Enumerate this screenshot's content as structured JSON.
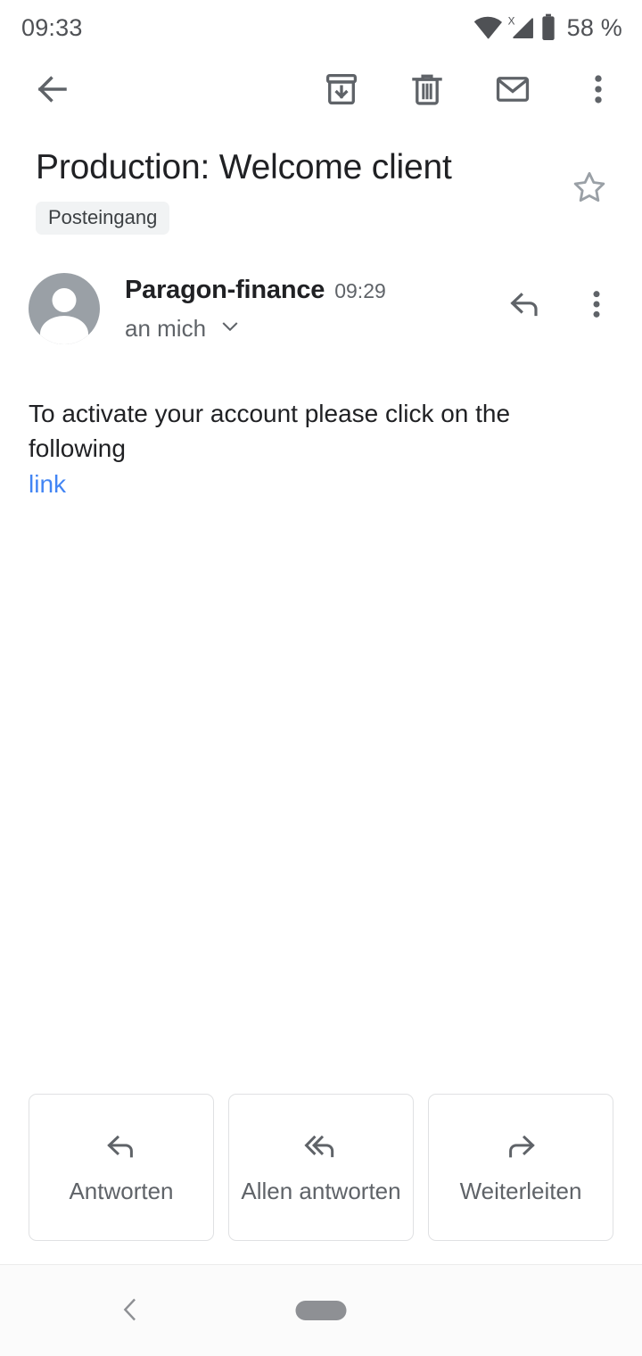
{
  "status_bar": {
    "time": "09:33",
    "battery_percent": "58 %",
    "icons": [
      "wifi-icon",
      "cellular-signal-no-service-icon",
      "battery-icon"
    ]
  },
  "toolbar": {
    "back_icon": "back-arrow-icon",
    "archive_icon": "archive-icon",
    "delete_icon": "trash-icon",
    "mark_unread_icon": "envelope-icon",
    "overflow_icon": "more-vertical-icon"
  },
  "email": {
    "subject": "Production: Welcome client",
    "label": "Posteingang",
    "starred": false,
    "star_icon": "star-outline-icon",
    "sender_name": "Paragon-finance",
    "timestamp": "09:29",
    "recipient": "an mich",
    "recipient_expand_icon": "chevron-down-icon",
    "reply_icon": "reply-arrow-icon",
    "overflow_icon": "more-vertical-icon",
    "avatar_icon": "person-avatar-icon",
    "body_text": "To activate your account please click on the following",
    "body_link": "link"
  },
  "actions": [
    {
      "label": "Antworten",
      "icon": "reply-arrow-icon"
    },
    {
      "label": "Allen antworten",
      "icon": "reply-all-arrow-icon"
    },
    {
      "label": "Weiterleiten",
      "icon": "forward-arrow-icon"
    }
  ],
  "nav_bar": {
    "back_icon": "nav-back-chevron-icon",
    "home_icon": "nav-home-pill-icon"
  },
  "colors": {
    "link": "#4285f4",
    "icon": "#5f6368",
    "text_primary": "#202124",
    "text_secondary": "#5f6368",
    "chip_bg": "#f1f3f4",
    "avatar_bg": "#9aa0a6"
  }
}
